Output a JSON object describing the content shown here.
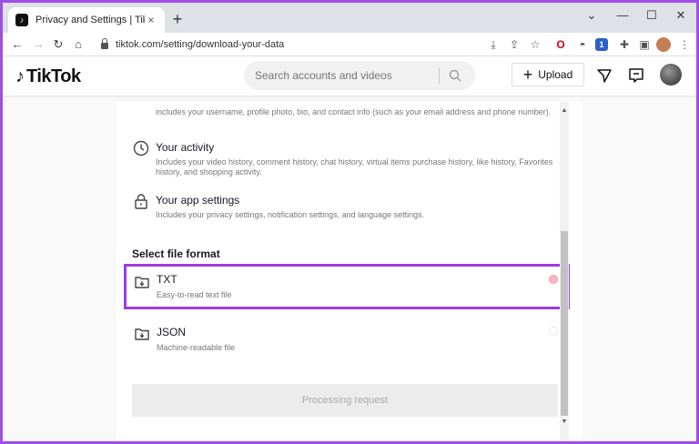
{
  "browser": {
    "tab_title": "Privacy and Settings | TikTok",
    "tab_close": "×",
    "newtab": "+",
    "url": "tiktok.com/setting/download-your-data",
    "ext_badge": "1"
  },
  "tiktok": {
    "logo": "TikTok",
    "search_placeholder": "Search accounts and videos",
    "upload_label": "Upload"
  },
  "content": {
    "cut_text": "includes your username, profile photo, bio, and contact info (such as your email address and phone number).",
    "items": [
      {
        "title": "Your activity",
        "desc": "Includes your video history, comment history, chat history, virtual items purchase history, like history, Favorites history, and shopping activity."
      },
      {
        "title": "Your app settings",
        "desc": "Includes your privacy settings, notification settings, and language settings."
      }
    ],
    "section_title": "Select file format",
    "formats": [
      {
        "title": "TXT",
        "desc": "Easy-to-read text file",
        "selected": true
      },
      {
        "title": "JSON",
        "desc": "Machine-readable file",
        "selected": false
      }
    ],
    "process_button": "Processing request"
  },
  "colors": {
    "highlight": "#a03be0",
    "radio_selected": "#f7b8c2"
  }
}
